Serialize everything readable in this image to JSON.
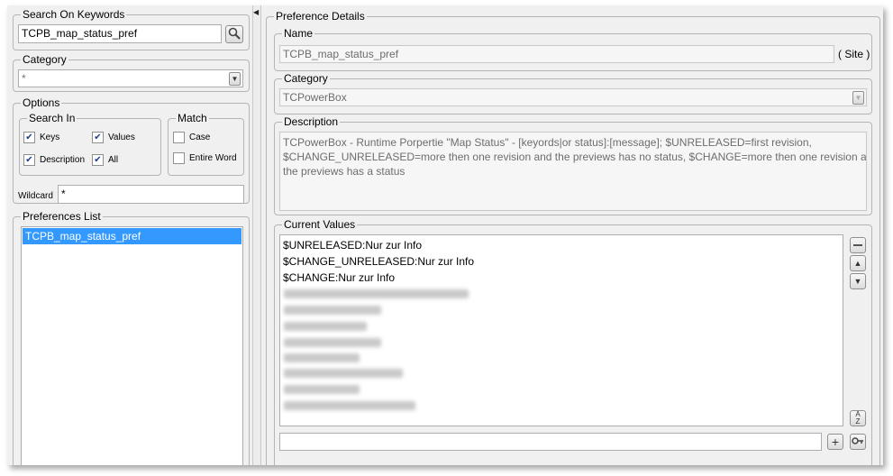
{
  "search": {
    "legend": "Search On Keywords",
    "value": "TCPB_map_status_pref"
  },
  "category_filter": {
    "legend": "Category",
    "value": "*"
  },
  "options": {
    "legend": "Options",
    "search_in": {
      "legend": "Search In",
      "keys": "Keys",
      "values": "Values",
      "description": "Description",
      "all": "All"
    },
    "match": {
      "legend": "Match",
      "case": "Case",
      "entire_word": "Entire Word"
    },
    "wildcard_label": "Wildcard",
    "wildcard_value": "*"
  },
  "preferences_list": {
    "legend": "Preferences List",
    "items": [
      "TCPB_map_status_pref"
    ]
  },
  "details": {
    "legend": "Preference Details",
    "name": {
      "legend": "Name",
      "value": "TCPB_map_status_pref",
      "scope": "( Site )"
    },
    "category": {
      "legend": "Category",
      "value": "TCPowerBox"
    },
    "description": {
      "legend": "Description",
      "lines": [
        "TCPowerBox - Runtime Porpertie \"Map Status\" - [keyords|or status]:[message]; $UNRELEASED=first revision,",
        "$CHANGE_UNRELEASED=more then one revision and the previews has no status, $CHANGE=more then one revision and",
        "the previews has a status"
      ]
    },
    "current_values": {
      "legend": "Current Values",
      "values": [
        "$UNRELEASED:Nur zur Info",
        "$CHANGE_UNRELEASED:Nur zur Info",
        "$CHANGE:Nur zur Info"
      ],
      "new_value": ""
    }
  }
}
